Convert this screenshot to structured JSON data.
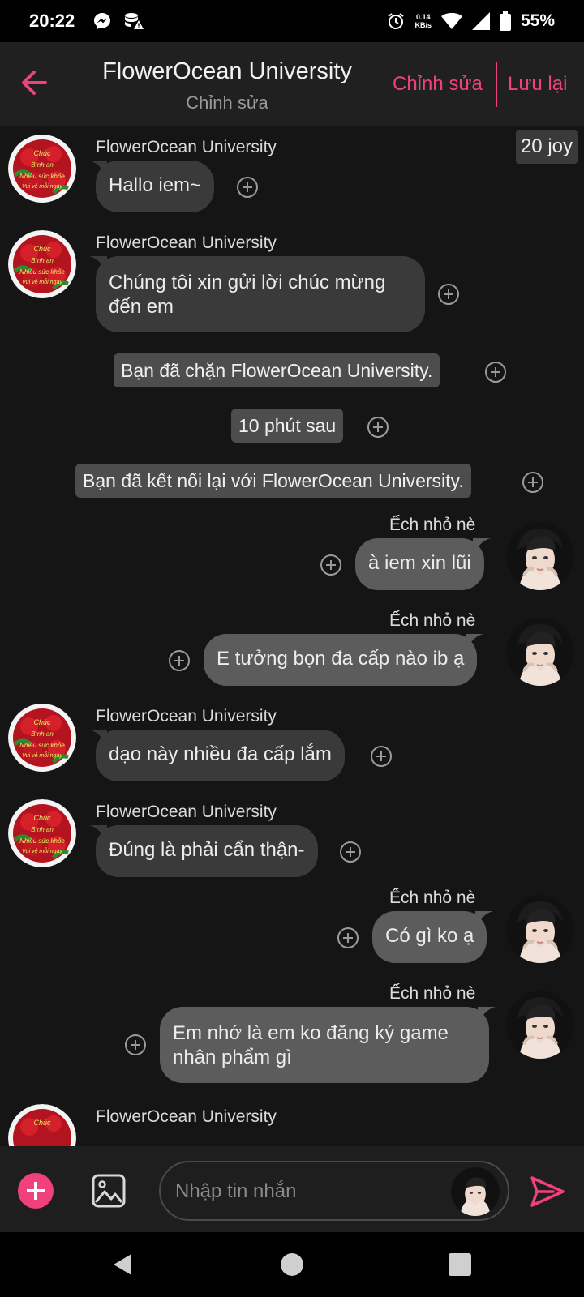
{
  "status_bar": {
    "time": "20:22",
    "net_speed_value": "0.14",
    "net_speed_unit": "KB/s",
    "battery": "55%",
    "icons": [
      "messenger-icon",
      "data-warning-icon",
      "alarm-icon",
      "wifi-icon",
      "signal-icon",
      "battery-icon"
    ]
  },
  "header": {
    "title": "FlowerOcean University",
    "subtitle": "Chỉnh sửa",
    "edit_label": "Chỉnh sửa",
    "save_label": "Lưu lại",
    "accent_color": "#f0417a"
  },
  "chat": {
    "joy_badge": "20 joy",
    "messages": [
      {
        "sender": "FlowerOcean University",
        "text": "Hallo iem~",
        "side": "left"
      },
      {
        "sender": "FlowerOcean University",
        "text_lines": [
          "Chúng tôi xin gửi lời chúc mừng",
          "đến em"
        ],
        "side": "left"
      },
      {
        "system": "Bạn đã chặn FlowerOcean University."
      },
      {
        "system": "10 phút sau"
      },
      {
        "system": "Bạn đã kết nối lại với FlowerOcean University."
      },
      {
        "sender": "Ếch nhỏ nè",
        "text": "à iem xin lũi",
        "side": "right"
      },
      {
        "sender": "Ếch nhỏ nè",
        "text": "E tưởng bọn đa cấp nào ib ạ",
        "side": "right"
      },
      {
        "sender": "FlowerOcean University",
        "text": "dạo này nhiều đa cấp lắm",
        "side": "left"
      },
      {
        "sender": "FlowerOcean University",
        "text": "Đúng là phải cẩn thận-",
        "side": "left"
      },
      {
        "sender": "Ếch nhỏ nè",
        "text": "Có gì ko ạ",
        "side": "right"
      },
      {
        "sender": "Ếch nhỏ nè",
        "text_lines": [
          "Em nhớ là em ko đăng ký game",
          "nhân phẩm gì"
        ],
        "side": "right"
      },
      {
        "sender": "FlowerOcean University",
        "side": "left"
      }
    ]
  },
  "input_bar": {
    "placeholder": "Nhập tin nhắn",
    "icons": [
      "add-icon",
      "image-icon",
      "send-icon"
    ]
  },
  "colors": {
    "background": "#151515",
    "bubble_other": "#3a3a3a",
    "bubble_mine": "#5c5c5c",
    "system": "#4d4d4d"
  }
}
